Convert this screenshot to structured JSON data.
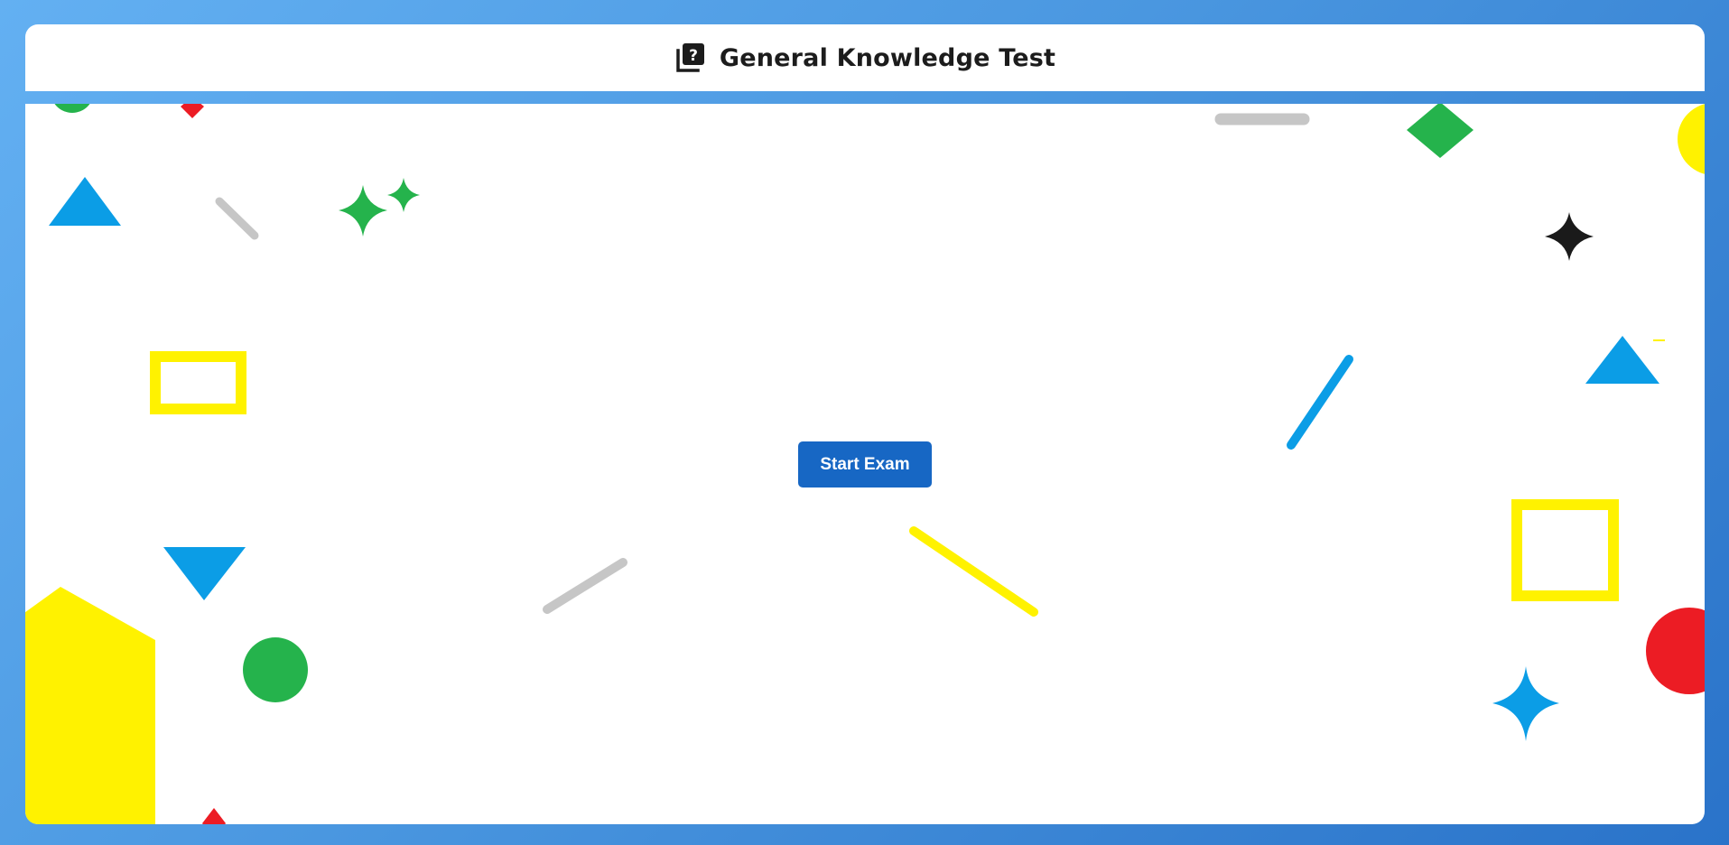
{
  "header": {
    "title": "General Knowledge Test",
    "icon": "quiz-question-icon"
  },
  "main": {
    "start_button_label": "Start Exam"
  },
  "colors": {
    "background_gradient": [
      "#63b0f2",
      "#2a73c9"
    ],
    "primary_button": "#1767c4",
    "shape_blue": "#0b9de6",
    "shape_green": "#25b34c",
    "shape_yellow": "#fff200",
    "shape_red": "#ec1c24",
    "shape_gray": "#c6c6c6",
    "shape_black": "#1a1a1a"
  }
}
